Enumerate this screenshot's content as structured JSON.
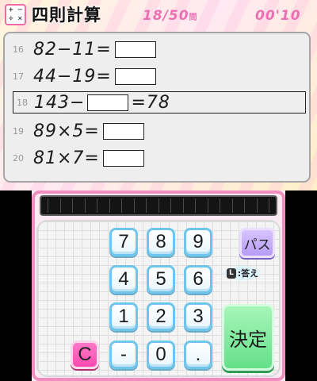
{
  "header": {
    "op_symbols": [
      "+",
      "−",
      "÷",
      "×"
    ],
    "title": "四則計算",
    "progress": "18/50",
    "progress_unit": "問",
    "timer": "00'10"
  },
  "questions": [
    {
      "number": "16",
      "expression": "82−11="
    },
    {
      "number": "17",
      "expression": "44−19="
    },
    {
      "number": "18",
      "expression_left": "143−",
      "expression_right": "=78",
      "active": true
    },
    {
      "number": "19",
      "expression": "89×5="
    },
    {
      "number": "20",
      "expression": "81×7="
    }
  ],
  "keypad": {
    "keys": [
      "7",
      "8",
      "9",
      "4",
      "5",
      "6",
      "1",
      "2",
      "3",
      "C",
      "-",
      "0",
      "."
    ],
    "pass_label": "パス",
    "enter_label": "決定",
    "hint_button": "L",
    "hint_label": ":答え"
  },
  "colors": {
    "accent_pink": "#ec6fb3",
    "key_border_blue": "#6ec6ec",
    "enter_green": "#66e08a",
    "pass_purple": "#b79cf5",
    "clear_pink": "#ff4aaf"
  }
}
